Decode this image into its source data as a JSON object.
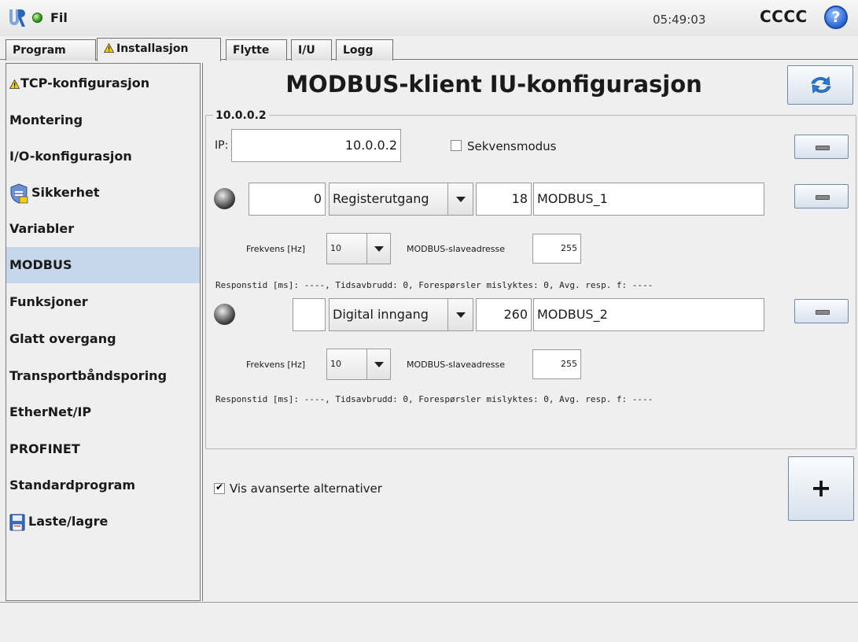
{
  "header": {
    "file_label": "Fil",
    "clock": "05:49:03",
    "robot_name": "CCCC",
    "help_symbol": "?"
  },
  "tabs": [
    {
      "label": "Program",
      "warning": false,
      "active": false
    },
    {
      "label": "Installasjon",
      "warning": true,
      "active": true
    },
    {
      "label": "Flytte",
      "warning": false,
      "active": false
    },
    {
      "label": "I/U",
      "warning": false,
      "active": false
    },
    {
      "label": "Logg",
      "warning": false,
      "active": false
    }
  ],
  "sidebar": {
    "items": [
      {
        "label": "TCP-konfigurasjon",
        "icon": "warning-icon"
      },
      {
        "label": "Montering"
      },
      {
        "label": "I/O-konfigurasjon"
      },
      {
        "label": "Sikkerhet",
        "icon": "shield-icon"
      },
      {
        "label": "Variabler"
      },
      {
        "label": "MODBUS",
        "active": true
      },
      {
        "label": "Funksjoner"
      },
      {
        "label": "Glatt overgang"
      },
      {
        "label": "Transportbåndsporing"
      },
      {
        "label": "EtherNet/IP"
      },
      {
        "label": "PROFINET"
      },
      {
        "label": "Standardprogram"
      },
      {
        "label": "Laste/lagre",
        "icon": "floppy-disk-icon"
      }
    ]
  },
  "main": {
    "title": "MODBUS-klient IU-konfigurasjon",
    "unit": {
      "group_title": "10.0.0.2",
      "ip_label": "IP:",
      "ip_value": "10.0.0.2",
      "sequential_label": "Sekvensmodus",
      "sequential_checked": false,
      "signals": [
        {
          "value": "0",
          "type": "Registerutgang",
          "address": "18",
          "name": "MODBUS_1",
          "freq_label": "Frekvens [Hz]",
          "freq_value": "10",
          "slave_label": "MODBUS-slaveadresse",
          "slave_value": "255",
          "response": "Responstid [ms]: ----, Tidsavbrudd: 0, Forespørsler mislyktes: 0, Avg. resp. f: ----"
        },
        {
          "value": "",
          "type": "Digital inngang",
          "address": "260",
          "name": "MODBUS_2",
          "freq_label": "Frekvens [Hz]",
          "freq_value": "10",
          "slave_label": "MODBUS-slaveadresse",
          "slave_value": "255",
          "response": "Responstid [ms]: ----, Tidsavbrudd: 0, Forespørsler mislyktes: 0, Avg. resp. f: ----"
        }
      ]
    },
    "advanced_label": "Vis avanserte alternativer",
    "advanced_checked": true,
    "add_unit_symbol": "+"
  },
  "colors": {
    "active_nav": "#c7d7eb",
    "status_ok": "#2f9a12",
    "help_blue": "#2f6cd9",
    "warning_yellow": "#f4d000"
  }
}
